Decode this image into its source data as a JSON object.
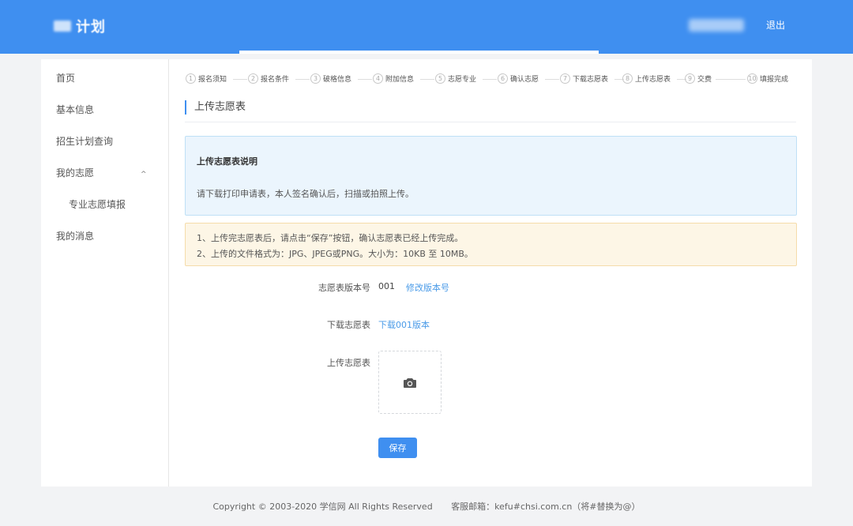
{
  "header": {
    "logo_text": "计划",
    "logout_label": "退出"
  },
  "sidebar": {
    "items": [
      {
        "label": "首页"
      },
      {
        "label": "基本信息"
      },
      {
        "label": "招生计划查询"
      },
      {
        "label": "我的志愿"
      },
      {
        "label": "专业志愿填报"
      },
      {
        "label": "我的消息"
      }
    ]
  },
  "steps": [
    {
      "num": "1",
      "label": "报名须知"
    },
    {
      "num": "2",
      "label": "报名条件"
    },
    {
      "num": "3",
      "label": "破格信息"
    },
    {
      "num": "4",
      "label": "附加信息"
    },
    {
      "num": "5",
      "label": "志愿专业"
    },
    {
      "num": "6",
      "label": "确认志愿"
    },
    {
      "num": "7",
      "label": "下载志愿表"
    },
    {
      "num": "8",
      "label": "上传志愿表"
    },
    {
      "num": "9",
      "label": "交费"
    },
    {
      "num": "10",
      "label": "填报完成"
    }
  ],
  "main": {
    "section_title": "上传志愿表",
    "info": {
      "title": "上传志愿表说明",
      "text": "请下载打印申请表，本人签名确认后，扫描或拍照上传。"
    },
    "notice": [
      "1、上传完志愿表后，请点击“保存”按钮，确认志愿表已经上传完成。",
      "2、上传的文件格式为：JPG、JPEG或PNG。大小为：10KB 至 10MB。"
    ],
    "form": {
      "version_label": "志愿表版本号",
      "version_value": "001",
      "version_link": "修改版本号",
      "download_label": "下载志愿表",
      "download_link": "下载001版本",
      "upload_label": "上传志愿表",
      "save_label": "保存"
    }
  },
  "footer": {
    "copyright": "Copyright © 2003-2020 学信网 All Rights Reserved",
    "email": "客服邮箱：kefu#chsi.com.cn（将#替换为@）"
  },
  "colors": {
    "brand": "#3f8ff0",
    "link": "#4a9be8",
    "info_bg": "#ebf5fd",
    "warn_bg": "#fdf6e6"
  }
}
